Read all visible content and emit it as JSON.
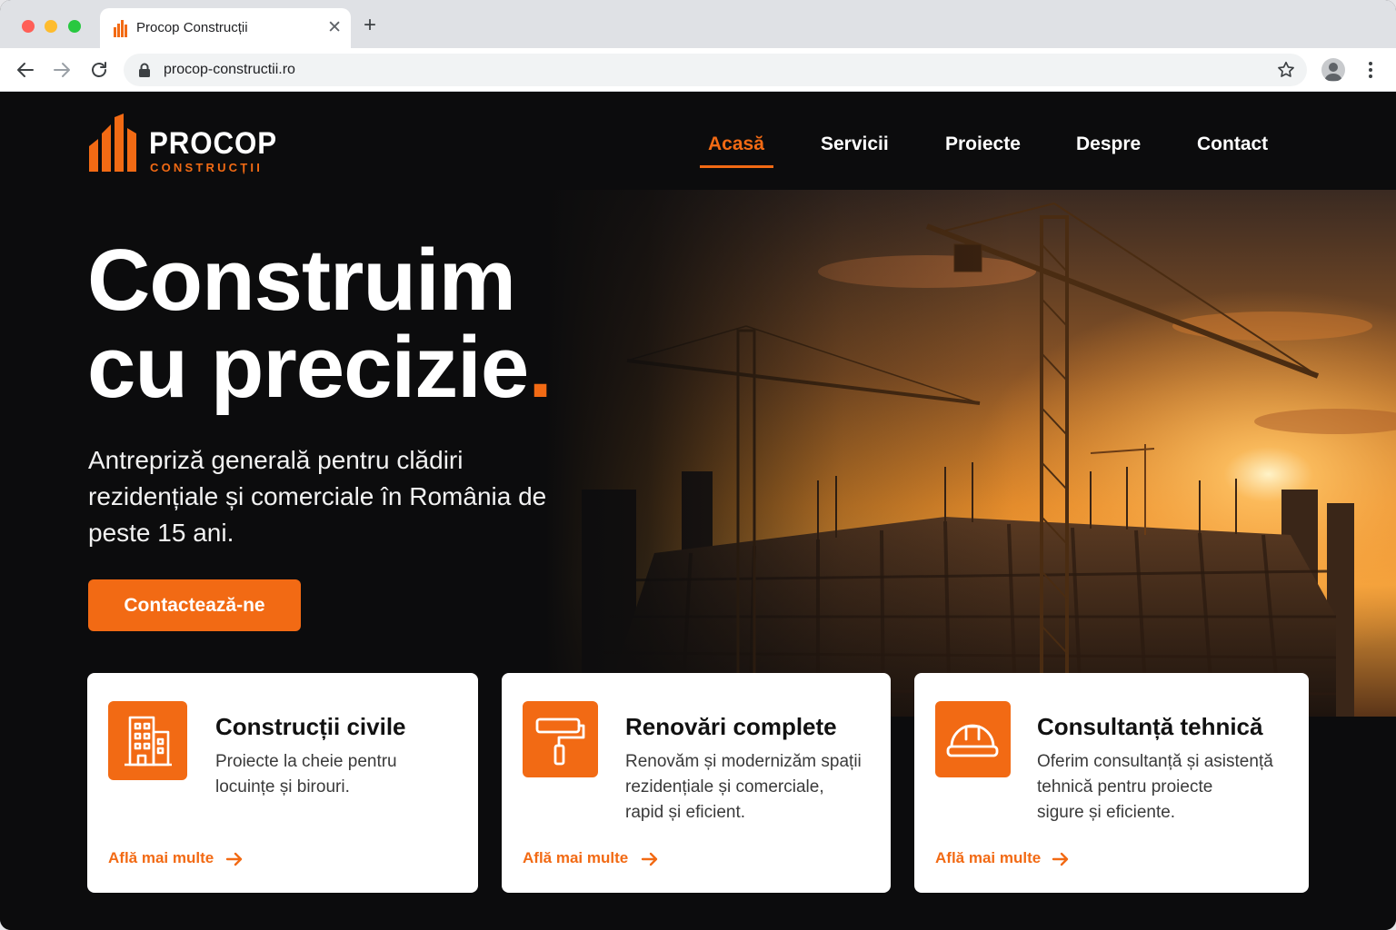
{
  "browser": {
    "tab_title": "Procop Construcții",
    "url": "procop-constructii.ro"
  },
  "site": {
    "logo": {
      "name": "PROCOP",
      "sub": "CONSTRUCȚII"
    },
    "nav": [
      {
        "label": "Acasă",
        "active": true
      },
      {
        "label": "Servicii",
        "active": false
      },
      {
        "label": "Proiecte",
        "active": false
      },
      {
        "label": "Despre",
        "active": false
      },
      {
        "label": "Contact",
        "active": false
      }
    ],
    "hero": {
      "line1": "Construim",
      "line2": "cu precizie",
      "dot": ".",
      "subtitle": "Antrepriză generală pentru clădiri rezidențiale și comerciale în România de peste 15 ani.",
      "cta": "Contactează-ne"
    },
    "cards": [
      {
        "icon": "building-icon",
        "title": "Construcții civile",
        "desc_lines": [
          "Proiecte la cheie pentru",
          "locuințe și birouri."
        ],
        "link": "Află mai multe"
      },
      {
        "icon": "paint-roller-icon",
        "title": "Renovări complete",
        "desc_lines": [
          "Renovăm și modernizăm spații",
          "rezidențiale și comerciale,",
          "rapid și eficient."
        ],
        "link": "Află mai multe"
      },
      {
        "icon": "hard-hat-icon",
        "title": "Consultanță tehnică",
        "desc_lines": [
          "Oferim consultanță și asistență",
          "tehnică pentru proiecte",
          "sigure și eficiente."
        ],
        "link": "Află mai multe"
      }
    ]
  },
  "colors": {
    "accent": "#f26a14",
    "background": "#0c0c0d",
    "card": "#ffffff"
  }
}
